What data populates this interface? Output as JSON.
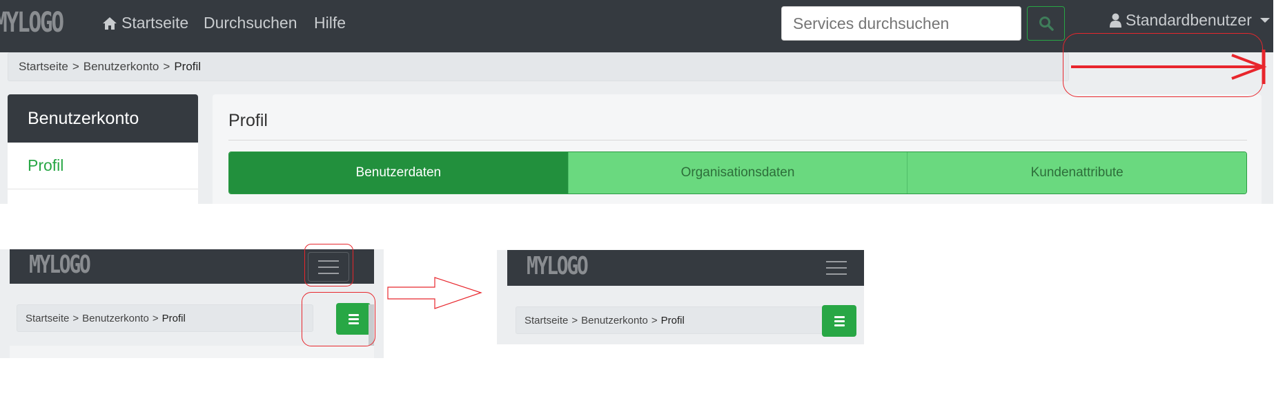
{
  "top": {
    "logo": "MYLOGO",
    "nav": {
      "home_label": "Startseite",
      "browse_label": "Durchsuchen",
      "help_label": "Hilfe"
    },
    "search": {
      "placeholder": "Services durchsuchen"
    },
    "user_label": "Standardbenutzer",
    "breadcrumb": {
      "home": "Startseite",
      "sep": ">",
      "account": "Benutzerkonto",
      "current": "Profil"
    },
    "sidebar": {
      "title": "Benutzerkonto",
      "items": [
        {
          "label": "Profil"
        }
      ]
    },
    "main": {
      "title": "Profil",
      "tabs": [
        {
          "label": "Benutzerdaten",
          "active": true
        },
        {
          "label": "Organisationsdaten",
          "active": false
        },
        {
          "label": "Kundenattribute",
          "active": false
        }
      ]
    }
  },
  "mobile_before": {
    "logo": "MYLOGO",
    "breadcrumb": {
      "home": "Startseite",
      "sep": ">",
      "account": "Benutzerkonto",
      "current": "Profil"
    }
  },
  "mobile_after": {
    "logo": "MYLOGO",
    "breadcrumb": {
      "home": "Startseite",
      "sep": ">",
      "account": "Benutzerkonto",
      "current": "Profil"
    }
  },
  "colors": {
    "navbar": "#353a40",
    "accent_green": "#28a745",
    "tab_active": "#22903d",
    "tab_inactive": "#6ad97f",
    "annotation_red": "#e8262c"
  },
  "icons": [
    "home-icon",
    "search-icon",
    "user-icon",
    "menu-icon",
    "arrow-right-icon"
  ]
}
